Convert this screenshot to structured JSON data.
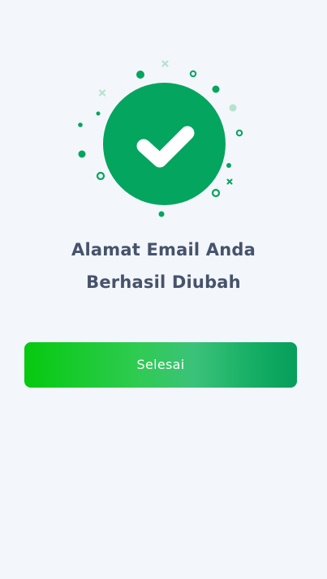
{
  "success": {
    "title_line1": "Alamat Email Anda",
    "title_line2": "Berhasil Diubah"
  },
  "actions": {
    "done_label": "Selesai"
  },
  "colors": {
    "background": "#f3f6fa",
    "success_green": "#04a55f",
    "title_text": "#46536c",
    "button_gradient_start": "#06c90f",
    "button_gradient_end": "#059e5b"
  },
  "icons": {
    "success": "check-circle-icon",
    "decoration": "confetti-icon"
  }
}
